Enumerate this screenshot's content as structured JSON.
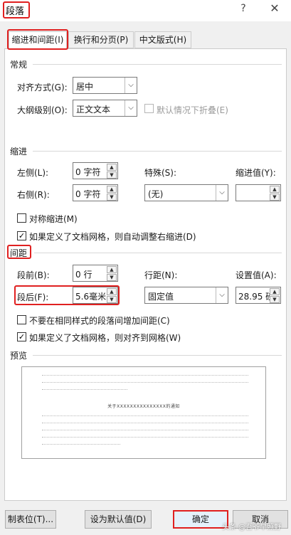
{
  "window": {
    "title": "段落",
    "help": "?",
    "close": "✕"
  },
  "tabs": [
    {
      "label": "缩进和间距(I)"
    },
    {
      "label": "换行和分页(P)"
    },
    {
      "label": "中文版式(H)"
    }
  ],
  "general": {
    "heading": "常规",
    "alignment_label": "对齐方式(G):",
    "alignment_value": "居中",
    "outline_label": "大纲级别(O):",
    "outline_value": "正文文本",
    "collapse_label": "默认情况下折叠(E)"
  },
  "indent": {
    "heading": "缩进",
    "left_label": "左侧(L):",
    "left_value": "0 字符",
    "right_label": "右侧(R):",
    "right_value": "0 字符",
    "special_label": "特殊(S):",
    "special_value": "(无)",
    "indent_by_label": "缩进值(Y):",
    "indent_by_value": "",
    "mirror_label": "对称缩进(M)",
    "auto_adjust_label": "如果定义了文档网格，则自动调整右缩进(D)"
  },
  "spacing": {
    "heading": "间距",
    "before_label": "段前(B):",
    "before_value": "0 行",
    "after_label": "段后(F):",
    "after_value": "5.6毫米",
    "line_label": "行距(N):",
    "line_value": "固定值",
    "at_label": "设置值(A):",
    "at_value": "28.95 磅",
    "no_space_label": "不要在相同样式的段落间增加间距(C)",
    "snap_grid_label": "如果定义了文档网格，则对齐到网格(W)"
  },
  "preview": {
    "heading": "预览",
    "sample_text": "关于XXXXXXXXXXXXXXX的通知"
  },
  "buttons": {
    "tabs": "制表位(T)...",
    "set_default": "设为默认值(D)",
    "ok": "确定",
    "cancel": "取消"
  },
  "watermark": "头条 @吾爷早照野",
  "colors": {
    "highlight": "#e02020",
    "ok_bg": "#e5f1fb"
  }
}
